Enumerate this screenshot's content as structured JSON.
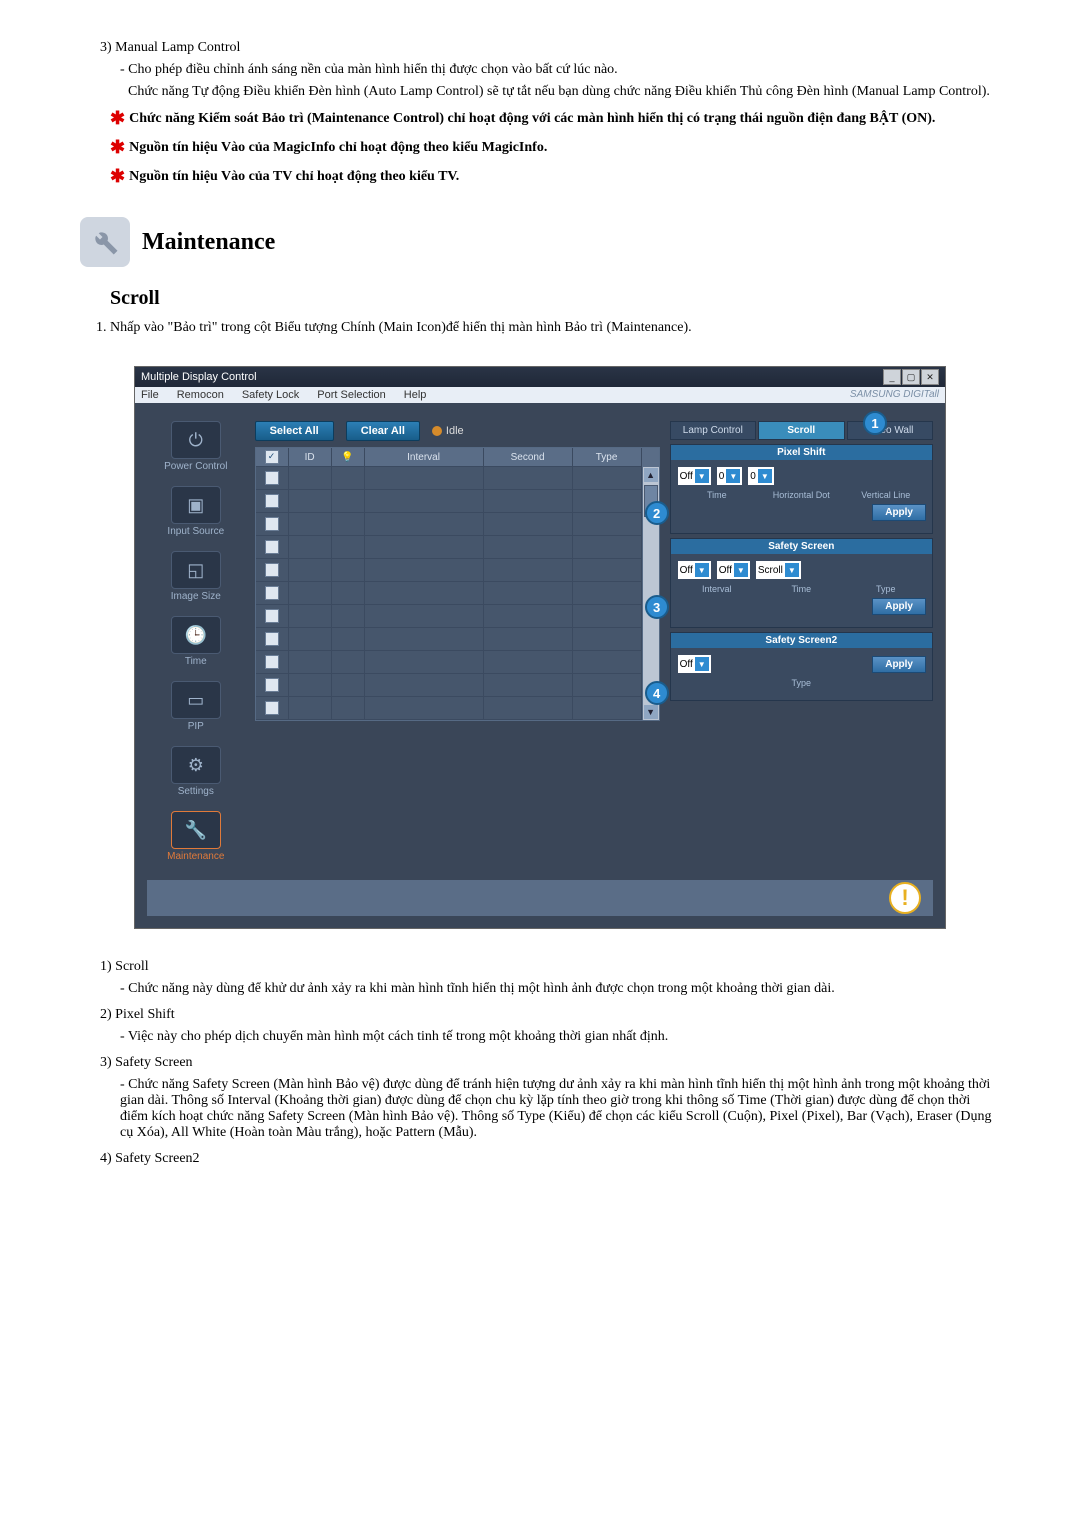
{
  "list_top": [
    {
      "num": "3)",
      "title": "Manual Lamp Control",
      "lines": [
        "- Cho phép điều chỉnh ánh sáng nền của màn hình hiển thị được chọn vào bất cứ lúc nào.",
        "Chức năng Tự động Điều khiển Đèn hình (Auto Lamp Control) sẽ tự tắt nếu bạn dùng chức năng Điều khiển Thủ công Đèn hình (Manual Lamp Control)."
      ]
    }
  ],
  "star_notes": [
    "Chức năng Kiểm soát Bảo trì (Maintenance Control) chỉ hoạt động với các màn hình hiển thị có trạng thái nguồn điện đang BẬT (ON).",
    "Nguồn tín hiệu Vào của MagicInfo chỉ hoạt động theo kiểu MagicInfo.",
    "Nguồn tín hiệu Vào của TV chỉ hoạt động theo kiểu TV."
  ],
  "section_title": "Maintenance",
  "sub_heading": "Scroll",
  "intro_item": "Nhấp vào \"Bảo trì\" trong cột Biểu tượng Chính (Main Icon)để hiển thị màn hình Bảo trì (Maintenance).",
  "app": {
    "title": "Multiple Display Control",
    "menu": [
      "File",
      "Remocon",
      "Safety Lock",
      "Port Selection",
      "Help"
    ],
    "brand": "SAMSUNG DIGITall",
    "sidebar": [
      {
        "label": "Power Control",
        "glyph": "⏻"
      },
      {
        "label": "Input Source",
        "glyph": "▣"
      },
      {
        "label": "Image Size",
        "glyph": "◱"
      },
      {
        "label": "Time",
        "glyph": "🕒"
      },
      {
        "label": "PIP",
        "glyph": "▭"
      },
      {
        "label": "Settings",
        "glyph": "⚙"
      },
      {
        "label": "Maintenance",
        "glyph": "🔧",
        "active": true
      }
    ],
    "buttons": {
      "select_all": "Select All",
      "clear_all": "Clear All",
      "idle": "Idle"
    },
    "columns": {
      "chk": "☑",
      "id": "ID",
      "lamp": "",
      "interval": "Interval",
      "second": "Second",
      "type": "Type"
    },
    "tabs": [
      "Lamp Control",
      "Scroll",
      "Video Wall"
    ],
    "active_tab": 1,
    "pixel_shift": {
      "title": "Pixel Shift",
      "off": "Off",
      "h": "0",
      "v": "0",
      "l1": "Time",
      "l2": "Horizontal Dot",
      "l3": "Vertical Line",
      "apply": "Apply"
    },
    "safety_screen": {
      "title": "Safety Screen",
      "off": "Off",
      "interval": "Off",
      "type": "Scroll",
      "l1": "Interval",
      "l2": "Time",
      "l3": "Type",
      "apply": "Apply"
    },
    "safety_screen2": {
      "title": "Safety Screen2",
      "off": "Off",
      "type_lbl": "Type",
      "apply": "Apply"
    },
    "markers": {
      "m1": "1",
      "m2": "2",
      "m3": "3",
      "m4": "4"
    }
  },
  "list_bottom": [
    {
      "num": "1)",
      "title": "Scroll",
      "lines": [
        "- Chức năng này dùng để khử dư ảnh xảy ra khi màn hình tĩnh hiển thị một hình ảnh được chọn trong một khoảng thời gian dài."
      ]
    },
    {
      "num": "2)",
      "title": "Pixel Shift",
      "lines": [
        "- Việc này cho phép dịch chuyển màn hình một cách tinh tế trong một khoảng thời gian nhất định."
      ]
    },
    {
      "num": "3)",
      "title": "Safety Screen",
      "lines": [
        "- Chức năng Safety Screen (Màn hình Bảo vệ) được dùng để tránh hiện tượng dư ảnh xảy ra khi màn hình tĩnh hiển thị một hình ảnh trong một khoảng thời gian dài. Thông số Interval (Khoảng thời gian) được dùng để chọn chu kỳ lặp tính theo giờ trong khi thông số Time (Thời gian) được dùng để chọn thời điểm kích hoạt chức năng Safety Screen (Màn hình Bảo vệ). Thông số Type (Kiểu) để chọn các kiểu Scroll (Cuộn), Pixel (Pixel), Bar (Vạch), Eraser (Dụng cụ Xóa), All White (Hoàn toàn Màu trắng), hoặc Pattern (Mẫu)."
      ]
    },
    {
      "num": "4)",
      "title": "Safety Screen2",
      "lines": []
    }
  ]
}
